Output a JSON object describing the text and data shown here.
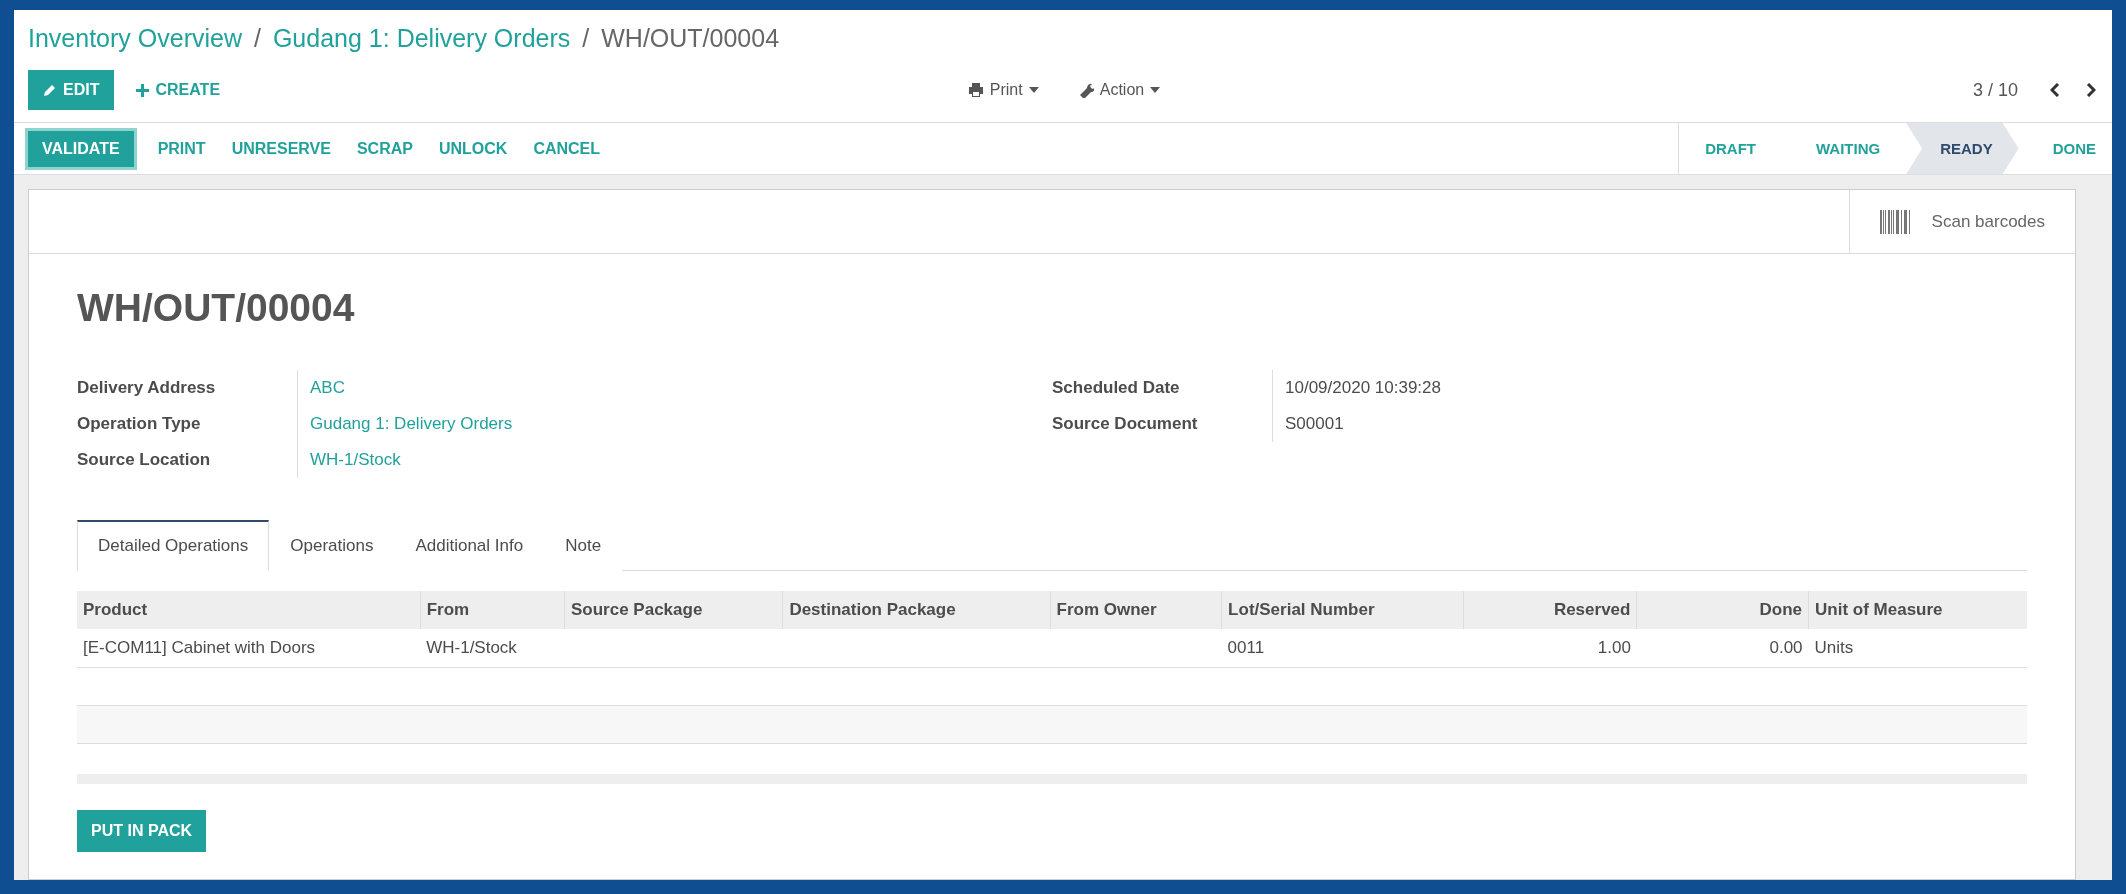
{
  "breadcrumbs": [
    {
      "label": "Inventory Overview",
      "kind": "link"
    },
    {
      "label": "Gudang 1: Delivery Orders",
      "kind": "link"
    },
    {
      "label": "WH/OUT/00004",
      "kind": "current"
    }
  ],
  "separator": "/",
  "toolbar": {
    "buttons": [
      {
        "label": "EDIT",
        "kind": "primary"
      },
      {
        "label": "CREATE",
        "kind": "link"
      }
    ],
    "menus": [
      "Print",
      "Action"
    ],
    "pager": "3 / 10"
  },
  "actions": [
    {
      "label": "VALIDATE",
      "kind": "primary"
    },
    {
      "label": "PRINT",
      "kind": "link"
    },
    {
      "label": "UNRESERVE",
      "kind": "link"
    },
    {
      "label": "SCRAP",
      "kind": "link"
    },
    {
      "label": "UNLOCK",
      "kind": "link"
    },
    {
      "label": "CANCEL",
      "kind": "link"
    }
  ],
  "statusbar": [
    {
      "label": "DRAFT",
      "selected": false
    },
    {
      "label": "WAITING",
      "selected": false
    },
    {
      "label": "READY",
      "selected": true
    },
    {
      "label": "DONE",
      "selected": false
    }
  ],
  "sheet": {
    "scan_button": "Scan barcodes",
    "title": "WH/OUT/00004",
    "left_fields": [
      {
        "label": "Delivery Address",
        "value": "ABC",
        "kind": "link"
      },
      {
        "label": "Operation Type",
        "value": "Gudang 1: Delivery Orders",
        "kind": "link"
      },
      {
        "label": "Source Location",
        "value": "WH-1/Stock",
        "kind": "link"
      }
    ],
    "right_fields": [
      {
        "label": "Scheduled Date",
        "value": "10/09/2020 10:39:28"
      },
      {
        "label": "Source Document",
        "value": "S00001"
      }
    ],
    "tabs": [
      {
        "label": "Detailed Operations",
        "selected": true
      },
      {
        "label": "Operations",
        "selected": false
      },
      {
        "label": "Additional Info",
        "selected": false
      },
      {
        "label": "Note",
        "selected": false
      }
    ],
    "table": {
      "columns": [
        {
          "label": "Product",
          "kind": "text"
        },
        {
          "label": "From",
          "kind": "text"
        },
        {
          "label": "Source Package",
          "kind": "text"
        },
        {
          "label": "Destination Package",
          "kind": "text"
        },
        {
          "label": "From Owner",
          "kind": "text"
        },
        {
          "label": "Lot/Serial Number",
          "kind": "text"
        },
        {
          "label": "Reserved",
          "kind": "number"
        },
        {
          "label": "Done",
          "kind": "number"
        },
        {
          "label": "Unit of Measure",
          "kind": "text"
        }
      ],
      "rows": [
        [
          "[E-COM11] Cabinet with Doors",
          "WH-1/Stock",
          "",
          "",
          "",
          "0011",
          "1.00",
          "0.00",
          "Units"
        ]
      ]
    },
    "footer_button": "PUT IN PACK"
  }
}
